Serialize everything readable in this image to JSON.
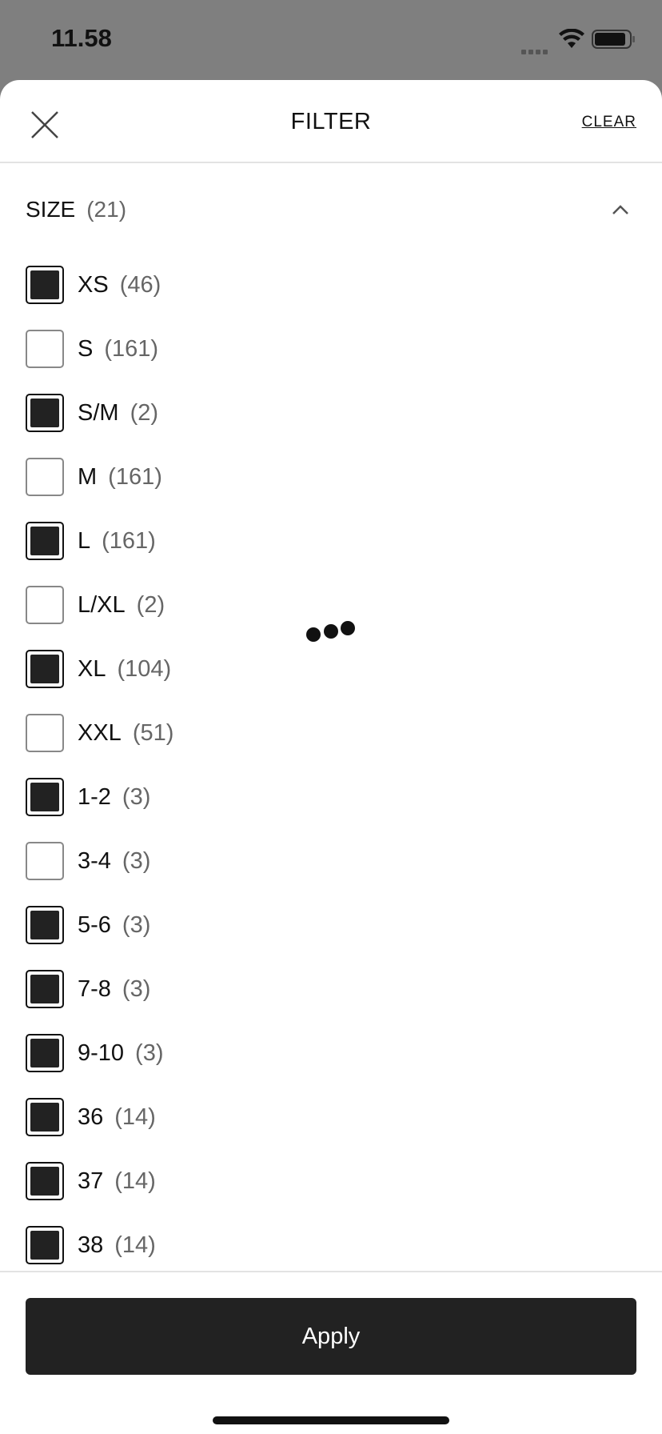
{
  "status_bar": {
    "time": "11.58"
  },
  "header": {
    "title": "FILTER",
    "clear_label": "CLEAR"
  },
  "section": {
    "title": "SIZE",
    "count": "(21)"
  },
  "options": [
    {
      "label": "XS",
      "count": "(46)",
      "checked": true
    },
    {
      "label": "S",
      "count": "(161)",
      "checked": false
    },
    {
      "label": "S/M",
      "count": "(2)",
      "checked": true
    },
    {
      "label": "M",
      "count": "(161)",
      "checked": false
    },
    {
      "label": "L",
      "count": "(161)",
      "checked": true
    },
    {
      "label": "L/XL",
      "count": "(2)",
      "checked": false
    },
    {
      "label": "XL",
      "count": "(104)",
      "checked": true
    },
    {
      "label": "XXL",
      "count": "(51)",
      "checked": false
    },
    {
      "label": "1-2",
      "count": "(3)",
      "checked": true
    },
    {
      "label": "3-4",
      "count": "(3)",
      "checked": false
    },
    {
      "label": "5-6",
      "count": "(3)",
      "checked": true
    },
    {
      "label": "7-8",
      "count": "(3)",
      "checked": true
    },
    {
      "label": "9-10",
      "count": "(3)",
      "checked": true
    },
    {
      "label": "36",
      "count": "(14)",
      "checked": true
    },
    {
      "label": "37",
      "count": "(14)",
      "checked": true
    },
    {
      "label": "38",
      "count": "(14)",
      "checked": true
    }
  ],
  "footer": {
    "apply_label": "Apply"
  },
  "colors": {
    "button_bg": "#222222",
    "checkbox_fill": "#222222",
    "sheet_bg": "#ffffff"
  }
}
